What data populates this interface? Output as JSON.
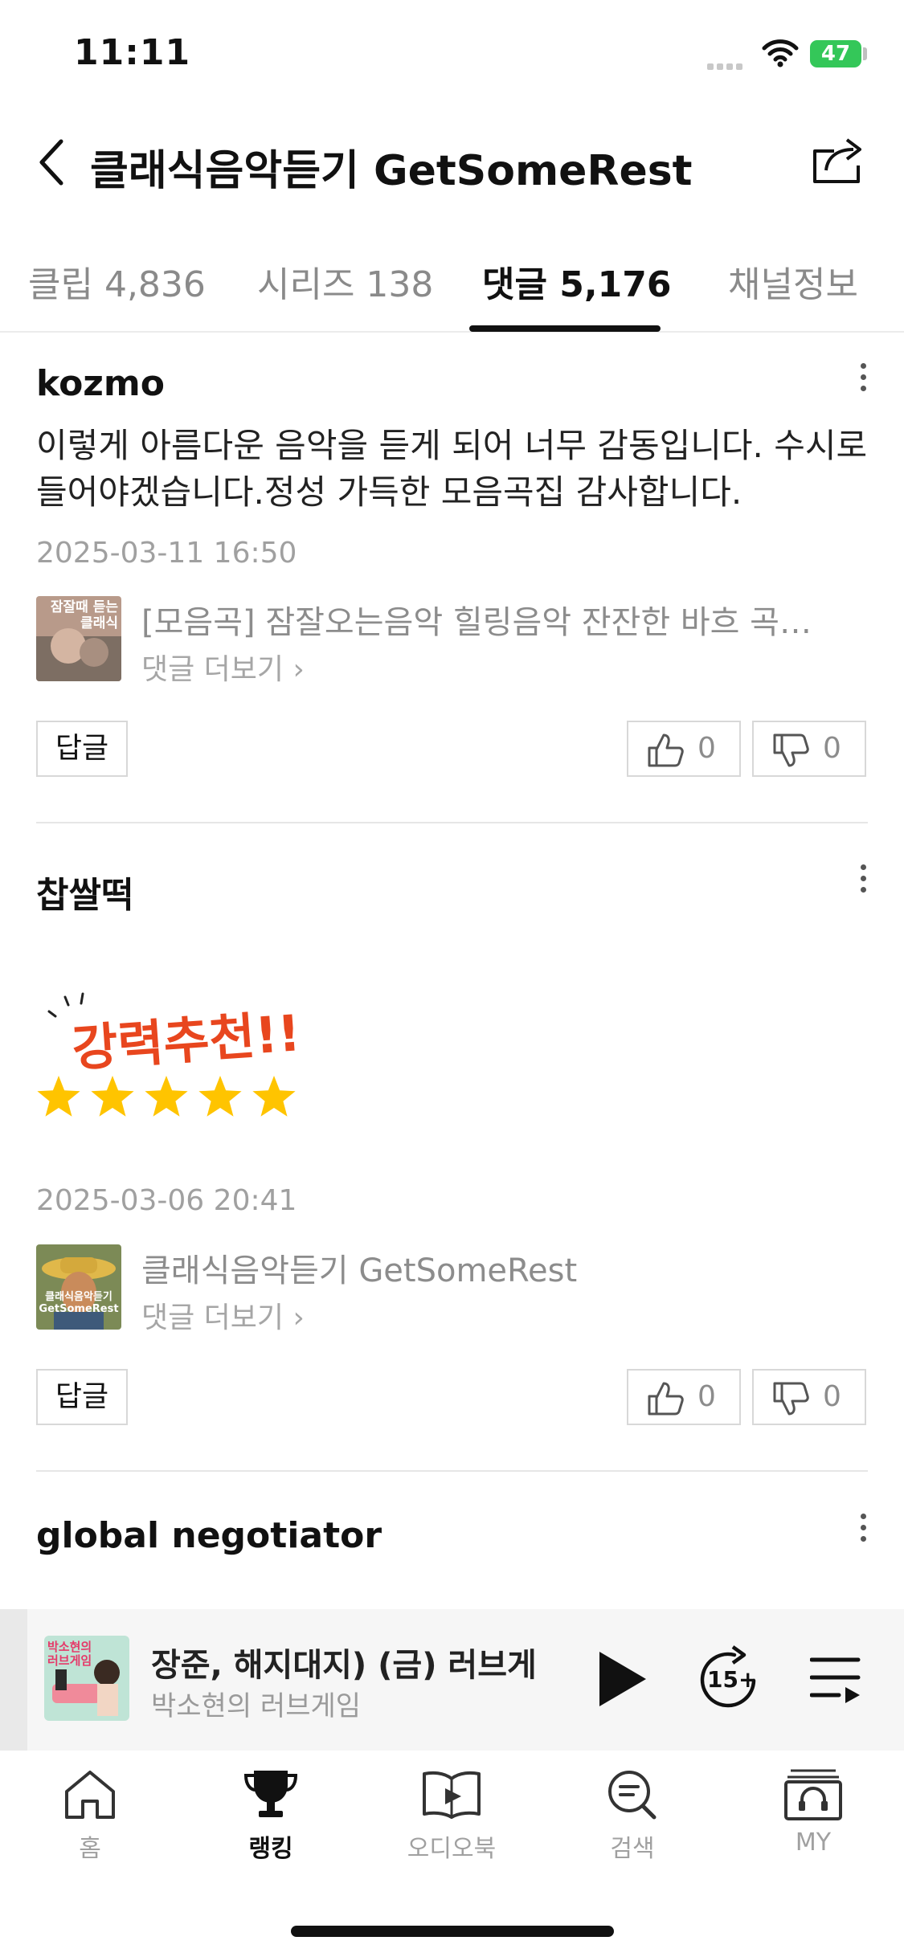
{
  "status_bar": {
    "time": "11:11",
    "battery": "47"
  },
  "header": {
    "title": "클래식음악듣기 GetSomeRest"
  },
  "tabs": [
    {
      "label": "클립 4,836"
    },
    {
      "label": "시리즈 138"
    },
    {
      "label": "댓글 5,176",
      "active": true
    },
    {
      "label": "채널정보"
    }
  ],
  "comments": [
    {
      "author": "kozmo",
      "text": "이렇게 아름다운 음악을 듣게 되어 너무 감동입니다. 수시로 들어야겠습니다.정성 가득한 모음곡집 감사합니다.",
      "date": "2025-03-11 16:50",
      "source_title": "[모음곡] 잠잘오는음악 힐링음악 잔잔한 바흐 곡…",
      "thumb_text": "잠잘때 듣는 클래식",
      "more_label": "댓글 더보기",
      "reply_label": "답글",
      "likes": "0",
      "dislikes": "0"
    },
    {
      "author": "찹쌀떡",
      "sticker_text": "강력추천!!",
      "rating": 5,
      "date": "2025-03-06 20:41",
      "source_title": "클래식음악듣기 GetSomeRest",
      "thumb_text": "클래식음악듣기 GetSomeRest",
      "more_label": "댓글 더보기",
      "reply_label": "답글",
      "likes": "0",
      "dislikes": "0"
    },
    {
      "author": "global negotiator"
    }
  ],
  "player": {
    "title": "장준, 해지대지)      (금) 러브게",
    "subtitle": "박소현의 러브게임",
    "art_text": "박소현의 러브게임",
    "skip_label": "15"
  },
  "nav": [
    {
      "label": "홈",
      "icon": "home-icon"
    },
    {
      "label": "랭킹",
      "icon": "trophy-icon",
      "active": true
    },
    {
      "label": "오디오북",
      "icon": "audiobook-icon"
    },
    {
      "label": "검색",
      "icon": "search-icon"
    },
    {
      "label": "MY",
      "icon": "my-icon"
    }
  ],
  "colors": {
    "accent_battery": "#34c759",
    "star": "#ffc400",
    "sticker_text": "#e8461e"
  }
}
